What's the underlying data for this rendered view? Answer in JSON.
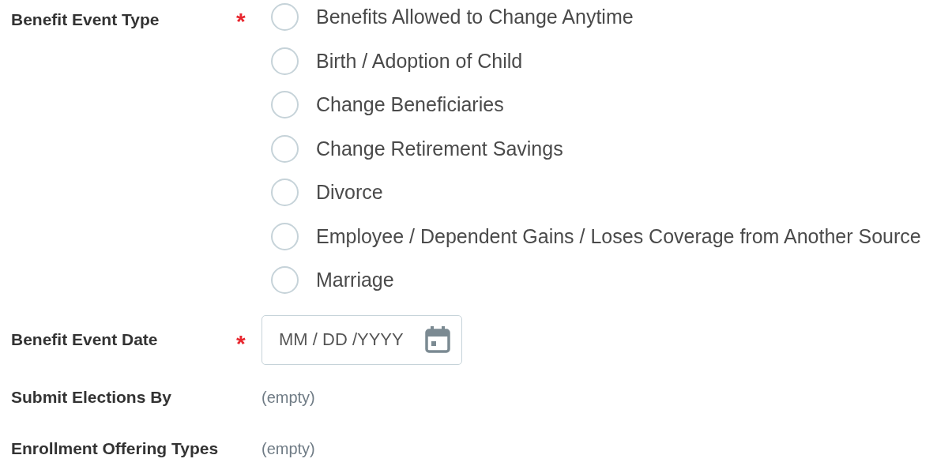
{
  "fields": [
    {
      "kind": "radio",
      "label": "Benefit Event Type",
      "required_mark": "*",
      "options": [
        {
          "label": "Benefits Allowed to Change Anytime",
          "selected": false
        },
        {
          "label": "Birth / Adoption of Child",
          "selected": false
        },
        {
          "label": "Change Beneficiaries",
          "selected": false
        },
        {
          "label": "Change Retirement Savings",
          "selected": false
        },
        {
          "label": "Divorce",
          "selected": false
        },
        {
          "label": "Employee / Dependent Gains / Loses Coverage from Another Source",
          "selected": false
        },
        {
          "label": "Marriage",
          "selected": false
        }
      ]
    },
    {
      "kind": "date",
      "label": "Benefit Event Date",
      "required_mark": "*",
      "placeholder": "MM / DD /YYYY"
    },
    {
      "kind": "readonly",
      "label": "Submit Elections By",
      "value": "(empty)"
    },
    {
      "kind": "readonly",
      "label": "Enrollment Offering Types",
      "value": "(empty)"
    }
  ]
}
